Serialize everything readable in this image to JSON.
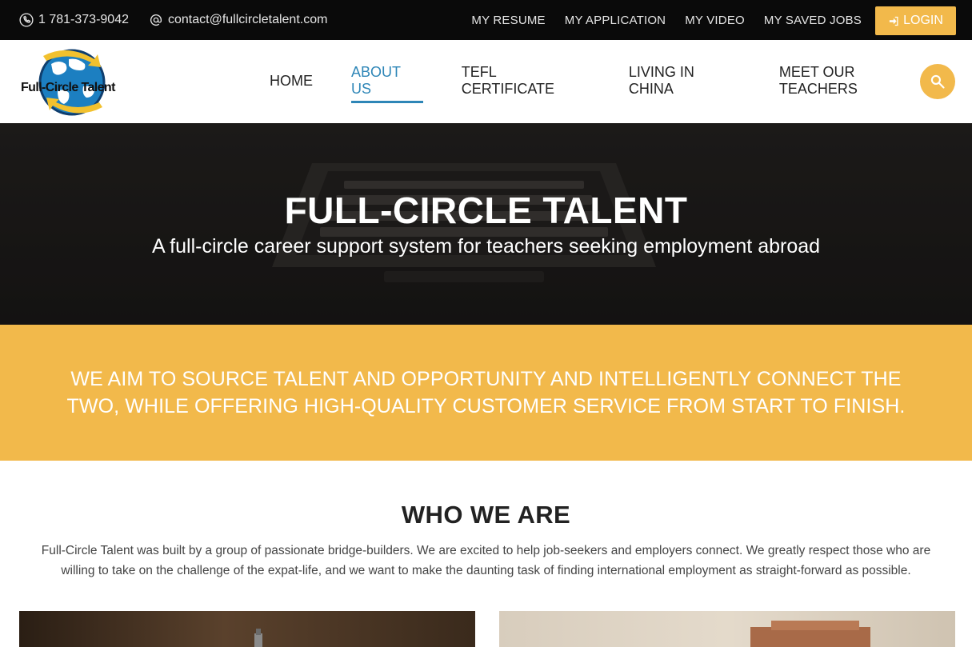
{
  "topbar": {
    "phone": "1 781-373-9042",
    "email": "contact@fullcircletalent.com",
    "links": [
      "MY RESUME",
      "MY APPLICATION",
      "MY VIDEO",
      "MY SAVED JOBS"
    ],
    "login_label": "LOGIN"
  },
  "header": {
    "logo_text": "Full-Circle Talent",
    "nav": [
      "HOME",
      "ABOUT US",
      "TEFL CERTIFICATE",
      "LIVING IN CHINA",
      "MEET OUR TEACHERS"
    ],
    "active_nav": "ABOUT US"
  },
  "hero": {
    "title": "FULL-CIRCLE TALENT",
    "subtitle": "A full-circle career support system for teachers seeking employment abroad"
  },
  "mission": {
    "text": "WE AIM TO SOURCE TALENT AND OPPORTUNITY AND INTELLIGENTLY CONNECT THE TWO, WHILE OFFERING HIGH-QUALITY CUSTOMER SERVICE FROM START TO FINISH."
  },
  "who_we_are": {
    "title": "WHO WE ARE",
    "body": "Full-Circle Talent was built by a group of passionate bridge-builders. We are excited to help job-seekers and employers connect. We greatly respect those who are willing to take on the challenge of the expat-life, and we want to make the daunting task of finding international employment as straight-forward as possible."
  },
  "colors": {
    "accent": "#f2b94b",
    "active_link": "#2e86b7",
    "topbar_bg": "#0a0a0a"
  },
  "icons": {
    "phone": "phone-icon",
    "email": "at-icon",
    "login": "sign-in-icon",
    "search": "search-icon"
  }
}
